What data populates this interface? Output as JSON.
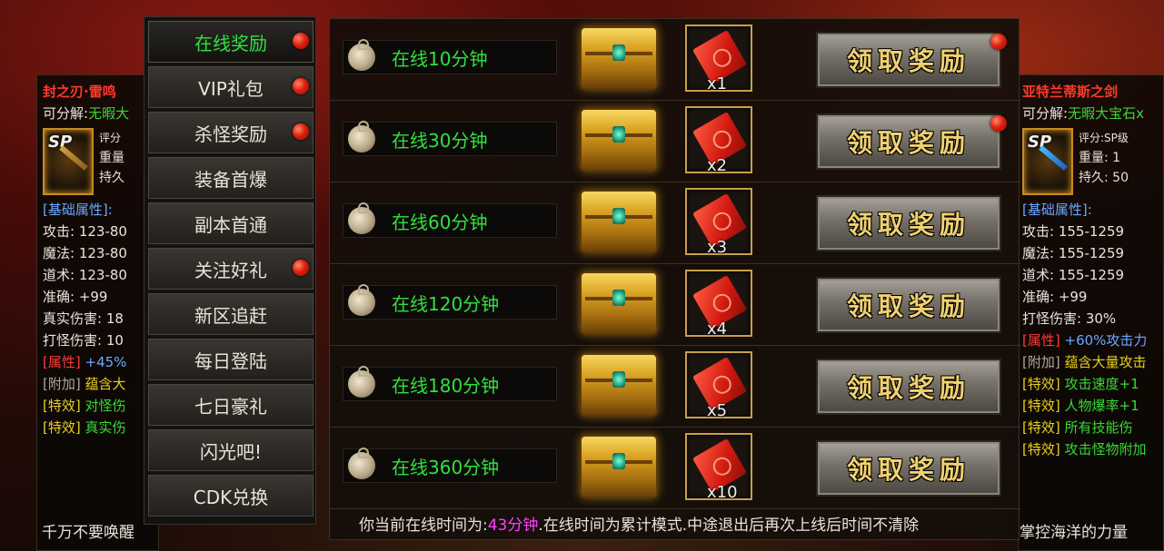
{
  "menu": {
    "items": [
      {
        "label": "在线奖励",
        "active": true,
        "dot": true
      },
      {
        "label": "VIP礼包",
        "active": false,
        "dot": true
      },
      {
        "label": "杀怪奖励",
        "active": false,
        "dot": true
      },
      {
        "label": "装备首爆",
        "active": false,
        "dot": false
      },
      {
        "label": "副本首通",
        "active": false,
        "dot": false
      },
      {
        "label": "关注好礼",
        "active": false,
        "dot": true
      },
      {
        "label": "新区追赶",
        "active": false,
        "dot": false
      },
      {
        "label": "每日登陆",
        "active": false,
        "dot": false
      },
      {
        "label": "七日豪礼",
        "active": false,
        "dot": false
      },
      {
        "label": "闪光吧!",
        "active": false,
        "dot": false
      },
      {
        "label": "CDK兑换",
        "active": false,
        "dot": false
      }
    ]
  },
  "rewards": [
    {
      "label": "在线10分钟",
      "qty": "x1",
      "button": "领取奖励",
      "dot": true
    },
    {
      "label": "在线30分钟",
      "qty": "x2",
      "button": "领取奖励",
      "dot": true
    },
    {
      "label": "在线60分钟",
      "qty": "x3",
      "button": "领取奖励",
      "dot": false
    },
    {
      "label": "在线120分钟",
      "qty": "x4",
      "button": "领取奖励",
      "dot": false
    },
    {
      "label": "在线180分钟",
      "qty": "x5",
      "button": "领取奖励",
      "dot": false
    },
    {
      "label": "在线360分钟",
      "qty": "x10",
      "button": "领取奖励",
      "dot": false
    }
  ],
  "footer": {
    "prefix": "你当前在线时间为:",
    "time": "43分钟",
    "suffix": ".在线时间为累计模式.中途退出后再次上线后时间不清除"
  },
  "left_tooltip": {
    "name": "封之刃·雷鸣",
    "decomp_label": "可分解:",
    "decomp_value": "无暇大",
    "sp": "SP",
    "rate": "评分",
    "weight": "重量",
    "durability": "持久",
    "base_header": "[基础属性]:",
    "attack": "攻击: 123-80",
    "magic": "魔法: 123-80",
    "tao": "道术: 123-80",
    "accuracy": "准确: +99",
    "true_dmg": "真实伤害: 18",
    "monster_dmg": "打怪伤害: 10",
    "attr_tag": "[属性]",
    "attr_value": "+45%",
    "extra_tag": "[附加]",
    "extra_value": "蕴含大",
    "fx1_tag": "[特效]",
    "fx1_value": "对怪伤",
    "fx2_tag": "[特效]",
    "fx2_value": "真实伤",
    "footer": "千万不要唤醒"
  },
  "right_tooltip": {
    "name": "亚特兰蒂斯之剑",
    "decomp_label": "可分解:",
    "decomp_value": "无暇大宝石x",
    "sp": "SP",
    "rate": "评分:SP级",
    "weight": "重量:  1",
    "durability": "持久:  50",
    "base_header": "[基础属性]:",
    "attack": "攻击: 155-1259",
    "magic": "魔法: 155-1259",
    "tao": "道术: 155-1259",
    "accuracy": "准确: +99",
    "monster_dmg": "打怪伤害: 30%",
    "attr_tag": "[属性]",
    "attr_value": "+60%攻击力",
    "extra_tag": "[附加]",
    "extra_value": "蕴含大量攻击",
    "fx1_tag": "[特效]",
    "fx1_value": "攻击速度+1",
    "fx2_tag": "[特效]",
    "fx2_value": "人物爆率+1",
    "fx3_tag": "[特效]",
    "fx3_value": "所有技能伤",
    "fx4_tag": "[特效]",
    "fx4_value": "攻击怪物附加",
    "footer": "掌控海洋的力量"
  },
  "colors": {
    "active_menu": "#30e040",
    "reward_label": "#30e040",
    "button_text": "#f0d070",
    "time_highlight": "#ff40ff"
  }
}
